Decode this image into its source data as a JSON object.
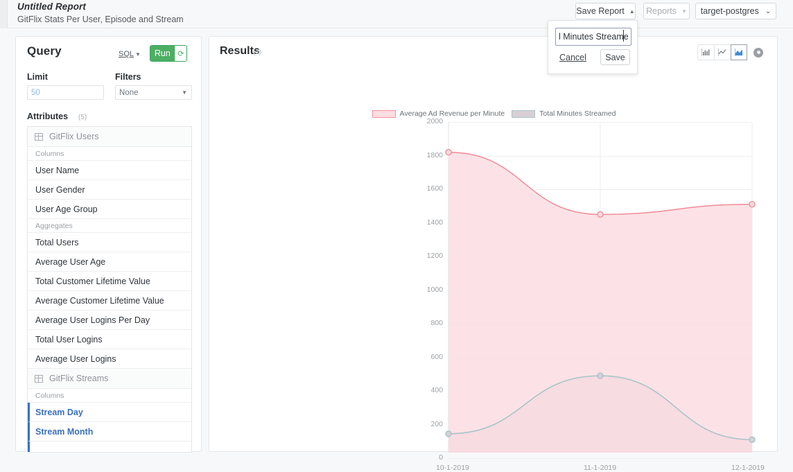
{
  "topbar": {
    "report_title": "Untitled Report",
    "report_subtitle": "GitFlix Stats Per User, Episode and Stream",
    "save_report_label": "Save Report",
    "save_report_caret": "▲",
    "reports_label": "Reports",
    "reports_caret": "▼",
    "database_label": "target-postgres",
    "database_caret": "⌄"
  },
  "save_popup": {
    "input_value": "l Minutes Streamed",
    "cancel_label": "Cancel",
    "save_label": "Save"
  },
  "query": {
    "title": "Query",
    "sql_link": "SQL",
    "sql_caret": "▼",
    "run_label": "Run",
    "refresh_icon": "⟳",
    "limit_label": "Limit",
    "limit_value": "50",
    "filters_label": "Filters",
    "filters_value": "None",
    "filters_caret": "▼",
    "attributes_label": "Attributes",
    "attributes_count": "(5)",
    "groups": [
      {
        "name": "GitFlix Users",
        "sections": [
          {
            "label": "Columns",
            "items": [
              {
                "label": "User Name",
                "selected": false
              },
              {
                "label": "User Gender",
                "selected": false
              },
              {
                "label": "User Age Group",
                "selected": false
              }
            ]
          },
          {
            "label": "Aggregates",
            "items": [
              {
                "label": "Total Users",
                "selected": false
              },
              {
                "label": "Average User Age",
                "selected": false
              },
              {
                "label": "Total Customer Lifetime Value",
                "selected": false
              },
              {
                "label": "Average Customer Lifetime Value",
                "selected": false
              },
              {
                "label": "Average User Logins Per Day",
                "selected": false
              },
              {
                "label": "Total User Logins",
                "selected": false
              },
              {
                "label": "Average User Logins",
                "selected": false
              }
            ]
          }
        ]
      },
      {
        "name": "GitFlix Streams",
        "sections": [
          {
            "label": "Columns",
            "items": [
              {
                "label": "Stream Day",
                "selected": true
              },
              {
                "label": "Stream Month",
                "selected": true
              },
              {
                "label": "",
                "selected": true
              }
            ]
          }
        ]
      }
    ]
  },
  "results": {
    "title": "Results",
    "count": "(3)",
    "toolbar": [
      {
        "icon": "bar-chart-icon",
        "active": false
      },
      {
        "icon": "line-chart-icon",
        "active": false
      },
      {
        "icon": "area-chart-icon",
        "active": true
      },
      {
        "icon": "gear-icon",
        "active": false
      }
    ]
  },
  "chart_data": {
    "type": "area",
    "title": "",
    "xlabel": "",
    "ylabel": "",
    "x": [
      "10-1-2019",
      "11-1-2019",
      "12-1-2019"
    ],
    "xticks": [
      "10-1-2019",
      "11-1-2019",
      "12-1-2019"
    ],
    "yticks": [
      0,
      200,
      400,
      600,
      800,
      1000,
      1200,
      1400,
      1600,
      1800,
      2000
    ],
    "ylim": [
      0,
      2000
    ],
    "grid": true,
    "legend_position": "top-center",
    "series": [
      {
        "name": "Average Ad Revenue per Minute",
        "color": "#f2919f",
        "fill": "#fbdde2",
        "values": [
          1820,
          1450,
          1510
        ]
      },
      {
        "name": "Total Minutes Streamed",
        "color": "#a8c4c8",
        "fill": "#d8d0d5",
        "values": [
          145,
          490,
          110
        ]
      }
    ]
  }
}
